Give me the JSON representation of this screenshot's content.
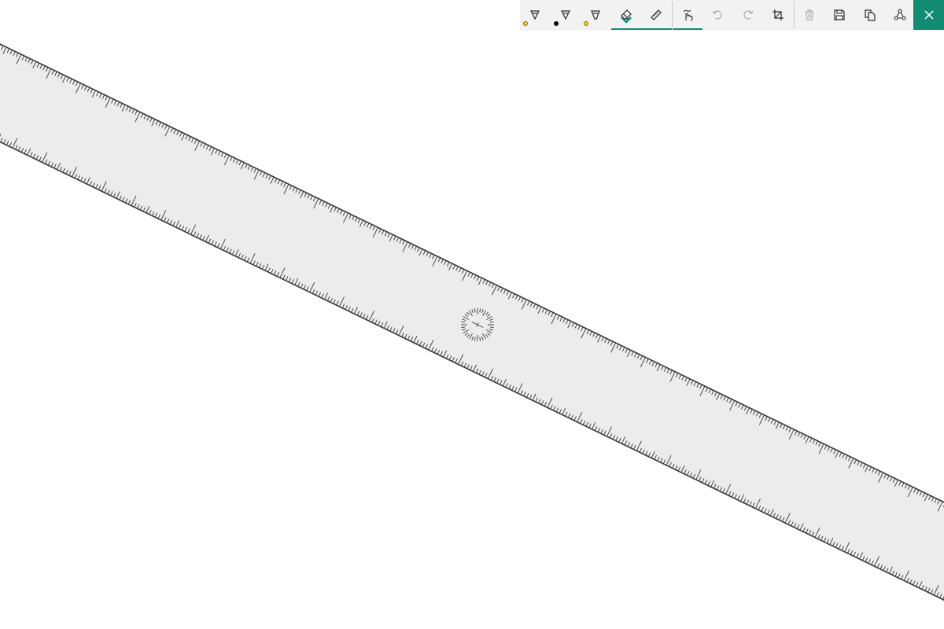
{
  "colors": {
    "toolbar_bg": "#f2f2f2",
    "accent": "#0f8b7a",
    "close_bg": "#138a72",
    "ruler_fill": "#ececec",
    "ruler_edge": "#3a3a3a",
    "tick": "#3a3a3a",
    "icon": "#2b2b2b"
  },
  "toolbar": {
    "buttons": [
      {
        "name": "ballpoint-pen",
        "icon": "ballpoint-pen-icon",
        "dot_color": "#f2dc21",
        "active": false
      },
      {
        "name": "pencil",
        "icon": "pencil-icon",
        "dot_color": "#000000",
        "active": false
      },
      {
        "name": "highlighter",
        "icon": "highlighter-icon",
        "dot_color": "#f2dc21",
        "active": false
      },
      {
        "name": "eraser",
        "icon": "eraser-icon",
        "active": true
      },
      {
        "name": "ruler",
        "icon": "ruler-icon",
        "active": false
      },
      {
        "name": "touch-writing",
        "icon": "touch-writing-icon",
        "active": true
      },
      {
        "name": "undo",
        "icon": "undo-icon",
        "disabled": true
      },
      {
        "name": "redo",
        "icon": "redo-icon",
        "disabled": true
      },
      {
        "name": "crop",
        "icon": "crop-icon"
      },
      {
        "name": "delete",
        "icon": "trash-icon",
        "disabled": true
      },
      {
        "name": "save",
        "icon": "save-icon"
      },
      {
        "name": "copy",
        "icon": "copy-icon"
      },
      {
        "name": "share",
        "icon": "share-icon"
      }
    ],
    "close": {
      "icon": "close-icon"
    }
  },
  "ruler": {
    "angle_degrees": 25.9,
    "protractor_icon": "angle-dial"
  }
}
